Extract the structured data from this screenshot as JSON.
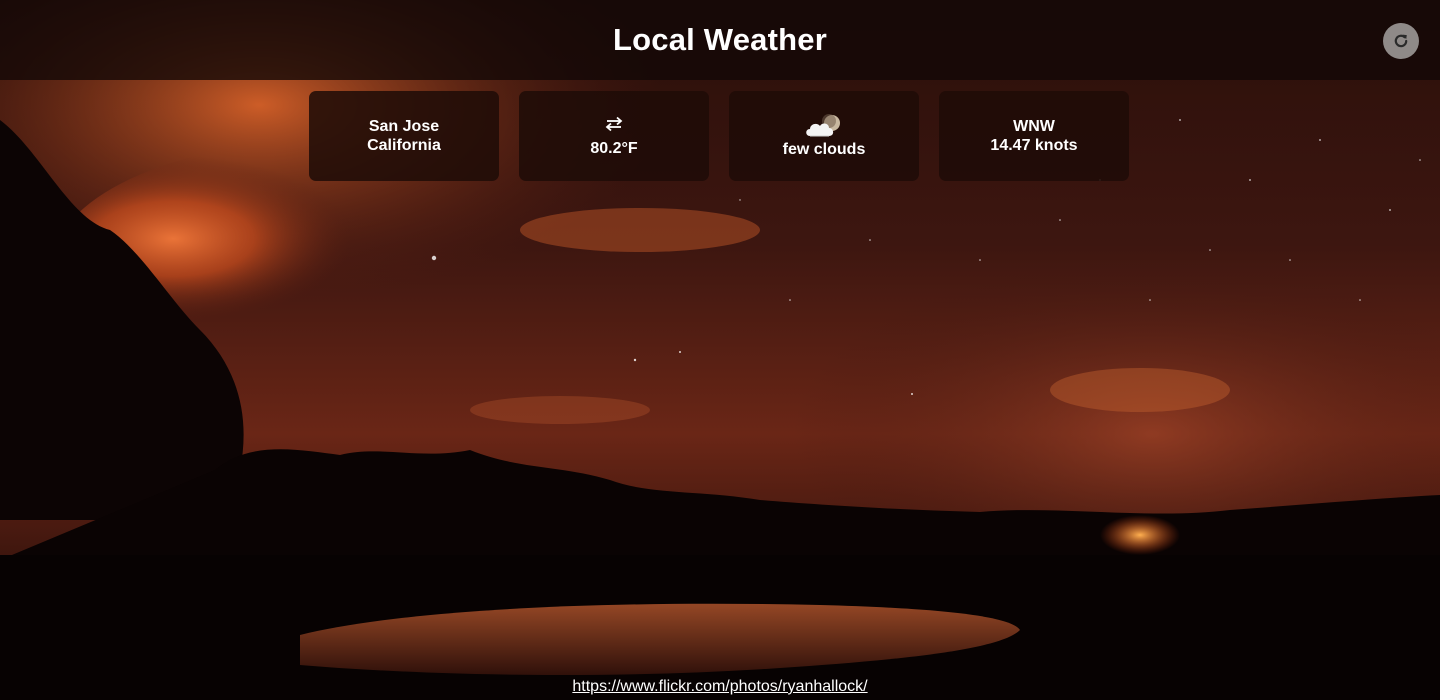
{
  "header": {
    "title": "Local Weather",
    "refresh_icon": "refresh-icon"
  },
  "location": {
    "city": "San Jose",
    "region": "California"
  },
  "temperature": {
    "toggle_icon": "swap-arrows-icon",
    "value": "80.2°F"
  },
  "conditions": {
    "icon": "few-clouds-night-icon",
    "description": "few clouds"
  },
  "wind": {
    "direction": "WNW",
    "speed": "14.47 knots"
  },
  "footer": {
    "photo_credit": "https://www.flickr.com/photos/ryanhallock/"
  },
  "colors": {
    "header_bg": "#120806",
    "card_bg": "#1e0c07",
    "text": "#ffffff",
    "refresh_button": "#8f8a88",
    "sky_glow": "#e8642a"
  }
}
